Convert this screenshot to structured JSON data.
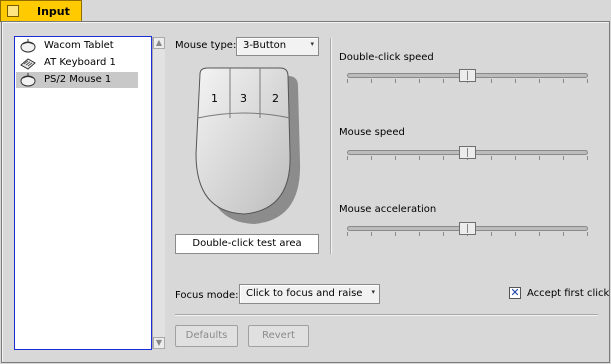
{
  "window": {
    "title": "Input"
  },
  "devices": [
    {
      "label": "Wacom Tablet",
      "icon": "mouse-icon",
      "selected": false
    },
    {
      "label": "AT Keyboard 1",
      "icon": "keyboard-icon",
      "selected": false
    },
    {
      "label": "PS/2 Mouse 1",
      "icon": "mouse-icon",
      "selected": true
    }
  ],
  "mouse_type": {
    "label": "Mouse type:",
    "value": "3-Button"
  },
  "mouse_buttons": [
    "1",
    "3",
    "2"
  ],
  "test_area": {
    "label": "Double-click test area"
  },
  "sliders": {
    "double_click_speed": {
      "label": "Double-click speed",
      "value": 0.5
    },
    "mouse_speed": {
      "label": "Mouse speed",
      "value": 0.5
    },
    "mouse_acceleration": {
      "label": "Mouse acceleration",
      "value": 0.5
    }
  },
  "focus_mode": {
    "label": "Focus mode:",
    "value": "Click to focus and raise"
  },
  "accept_first_click": {
    "label": "Accept first click",
    "checked": true
  },
  "buttons": {
    "defaults": "Defaults",
    "revert": "Revert"
  },
  "colors": {
    "tab": "#ffcb00",
    "selection": "#c8c8c8",
    "list_border": "#1c2bd8"
  }
}
